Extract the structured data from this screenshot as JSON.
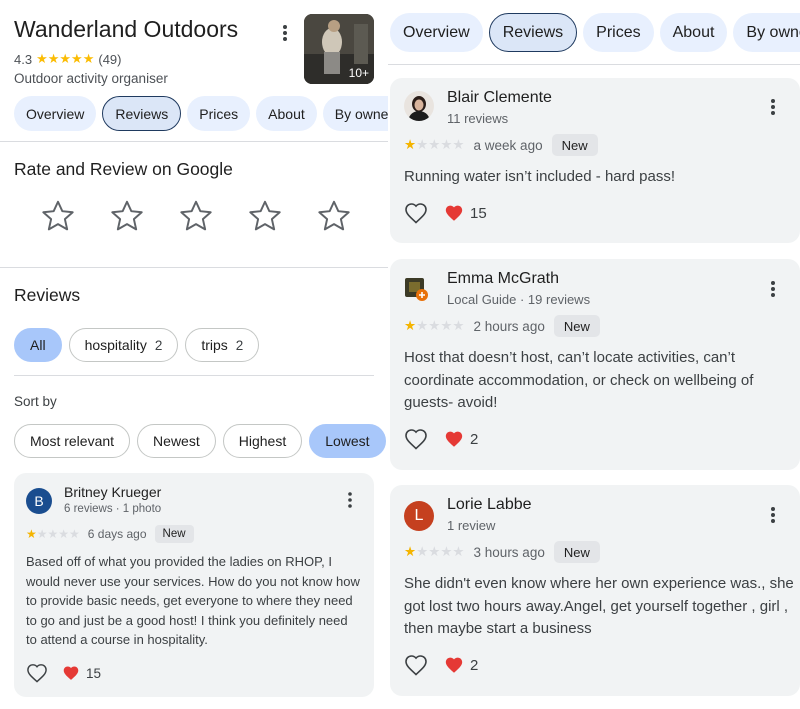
{
  "business": {
    "name": "Wanderland Outdoors",
    "rating": "4.3",
    "rating_stars": "★★★★★",
    "review_count": "(49)",
    "category": "Outdoor activity organiser",
    "photo_count": "10+"
  },
  "tabs": [
    "Overview",
    "Reviews",
    "Prices",
    "About",
    "By owner"
  ],
  "tabs_right": [
    "Overview",
    "Reviews",
    "Prices",
    "About",
    "By owner"
  ],
  "rate_section": {
    "title": "Rate and Review on Google"
  },
  "reviews_section": {
    "title": "Reviews",
    "filters": [
      {
        "label": "All",
        "count": ""
      },
      {
        "label": "hospitality",
        "count": "2"
      },
      {
        "label": "trips",
        "count": "2"
      }
    ],
    "sort_label": "Sort by",
    "sort_options": [
      "Most relevant",
      "Newest",
      "Highest",
      "Lowest"
    ],
    "selected_sort": "Lowest"
  },
  "left_review": {
    "avatar_letter": "B",
    "avatar_color": "#1a4d8f",
    "name": "Britney Krueger",
    "meta": "6 reviews · 1 photo",
    "stars": 1,
    "time": "6 days ago",
    "badge": "New",
    "text": "Based off of what you provided the ladies on RHOP, I would never use your services. How do you not know how to provide basic needs, get everyone to where they need to go and just be a good host! I think you definitely need to attend a course in hospitality.",
    "reactions": "15"
  },
  "right_reviews": [
    {
      "name": "Blair Clemente",
      "meta": "11 reviews",
      "stars": 1,
      "time": "a week ago",
      "badge": "New",
      "text": "Running water isn’t included - hard pass!",
      "reactions": "15"
    },
    {
      "name": "Emma McGrath",
      "meta": "Local Guide · 19 reviews",
      "stars": 1,
      "time": "2 hours ago",
      "badge": "New",
      "text": "Host that doesn’t host, can’t locate activities, can’t coordinate accommodation, or check on wellbeing of guests- avoid!",
      "reactions": "2"
    },
    {
      "name": "Lorie Labbe",
      "meta": "1 review",
      "avatar_letter": "L",
      "avatar_color": "#c5401f",
      "stars": 1,
      "time": "3 hours ago",
      "badge": "New",
      "text": "She didn't even know where her own experience was., she got lost two hours away.Angel, get yourself together , girl , then maybe start a business",
      "reactions": "2"
    }
  ],
  "colors": {
    "star_gold": "#f4b400",
    "chip_selected": "#a8c7fa",
    "tab_bg": "#e8f0fe",
    "heart_red": "#e53935"
  }
}
